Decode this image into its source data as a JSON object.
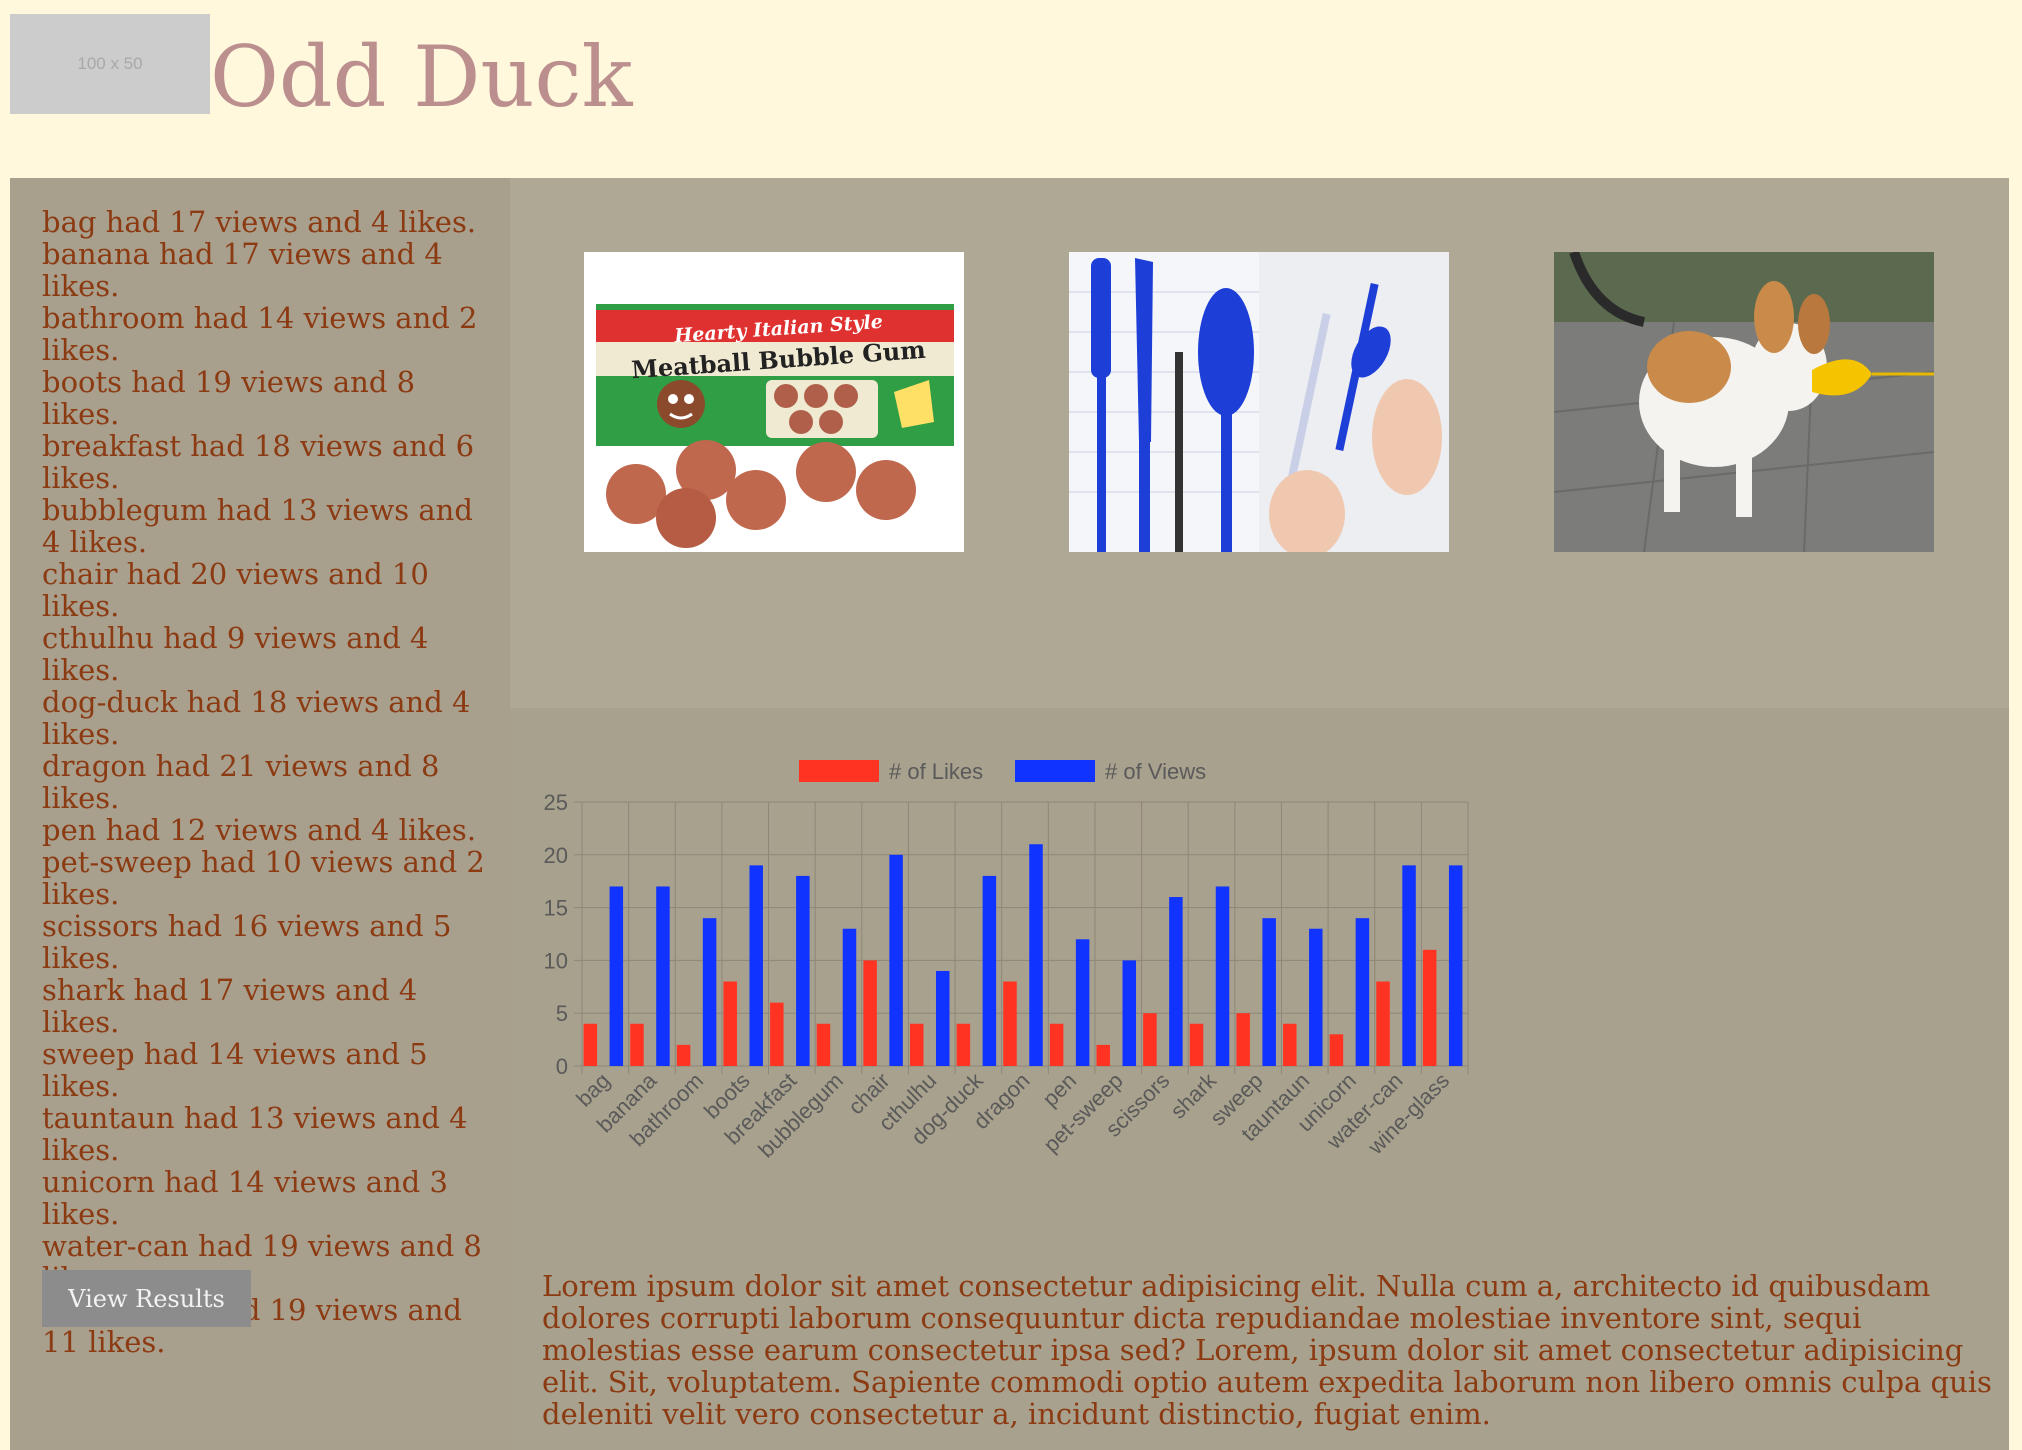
{
  "header": {
    "logo_placeholder": "100 x 50",
    "title": "Odd Duck"
  },
  "results": [
    "bag had 17 views and 4 likes.",
    "banana had 17 views and 4 likes.",
    "bathroom had 14 views and 2 likes.",
    "boots had 19 views and 8 likes.",
    "breakfast had 18 views and 6 likes.",
    "bubblegum had 13 views and 4 likes.",
    "chair had 20 views and 10 likes.",
    "cthulhu had 9 views and 4 likes.",
    "dog-duck had 18 views and 4 likes.",
    "dragon had 21 views and 8 likes.",
    "pen had 12 views and 4 likes.",
    "pet-sweep had 10 views and 2 likes.",
    "scissors had 16 views and 5 likes.",
    "shark had 17 views and 4 likes.",
    "sweep had 14 views and 5 likes.",
    "tauntaun had 13 views and 4 likes.",
    "unicorn had 14 views and 3 likes.",
    "water-can had 19 views and 8 likes.",
    "wine-glass had 19 views and 11 likes."
  ],
  "view_results_label": "View Results",
  "products": [
    {
      "name": "bubblegum",
      "box_line1": "Hearty Italian Style",
      "box_line2": "Meatball Bubble Gum"
    },
    {
      "name": "pen"
    },
    {
      "name": "dog-duck"
    }
  ],
  "lorem": "Lorem ipsum dolor sit amet consectetur adipisicing elit. Nulla cum a, architecto id quibusdam dolores corrupti laborum consequuntur dicta repudiandae molestiae inventore sint, sequi molestias esse earum consectetur ipsa sed? Lorem, ipsum dolor sit amet consectetur adipisicing elit. Sit, voluptatem. Sapiente commodi optio autem expedita laborum non libero omnis culpa quis deleniti velit vero consectetur a, incidunt distinctio, fugiat enim.",
  "colors": {
    "likes": "#ff3322",
    "views": "#1133ff"
  },
  "chart_data": {
    "type": "bar",
    "categories": [
      "bag",
      "banana",
      "bathroom",
      "boots",
      "breakfast",
      "bubblegum",
      "chair",
      "cthulhu",
      "dog-duck",
      "dragon",
      "pen",
      "pet-sweep",
      "scissors",
      "shark",
      "sweep",
      "tauntaun",
      "unicorn",
      "water-can",
      "wine-glass"
    ],
    "series": [
      {
        "name": "# of Likes",
        "values": [
          4,
          4,
          2,
          8,
          6,
          4,
          10,
          4,
          4,
          8,
          4,
          2,
          5,
          4,
          5,
          4,
          3,
          8,
          11
        ]
      },
      {
        "name": "# of Views",
        "values": [
          17,
          17,
          14,
          19,
          18,
          13,
          20,
          9,
          18,
          21,
          12,
          10,
          16,
          17,
          14,
          13,
          14,
          19,
          19
        ]
      }
    ],
    "ylim": [
      0,
      25
    ],
    "yticks": [
      0,
      5,
      10,
      15,
      20,
      25
    ],
    "grid": true,
    "legend": "top"
  }
}
